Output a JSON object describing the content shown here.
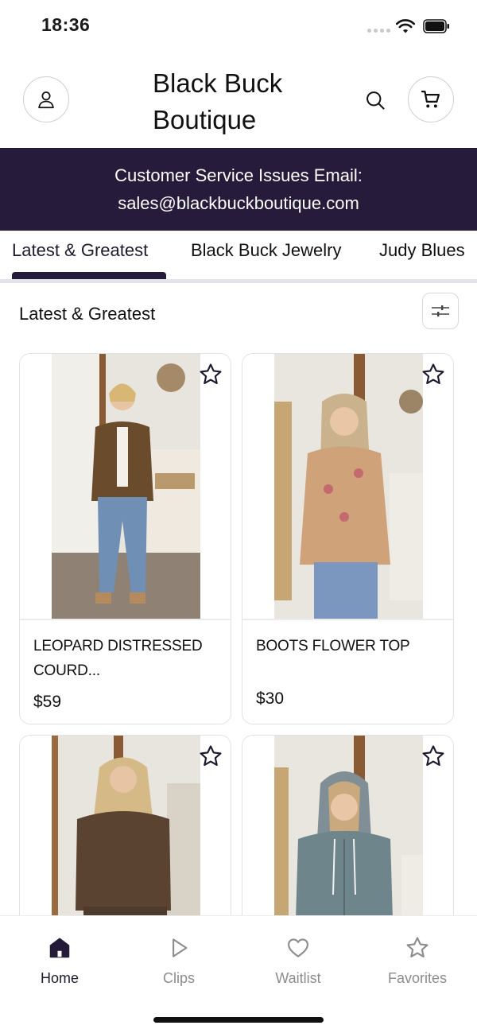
{
  "status_bar": {
    "time": "18:36"
  },
  "header": {
    "brand_line1": "Black Buck",
    "brand_line2": "Boutique",
    "icons": {
      "account": "user-icon",
      "search": "search-icon",
      "cart": "cart-icon"
    }
  },
  "banner": {
    "line1": "Customer Service Issues Email:",
    "line2": "sales@blackbuckboutique.com"
  },
  "tabs": [
    {
      "label": "Latest & Greatest",
      "active": true
    },
    {
      "label": "Black Buck Jewelry",
      "active": false
    },
    {
      "label": "Judy Blues",
      "active": false
    }
  ],
  "section": {
    "title": "Latest & Greatest"
  },
  "products": [
    {
      "title": "LEOPARD DISTRESSED COURD...",
      "price": "$59",
      "favorited": false
    },
    {
      "title": "BOOTS FLOWER TOP",
      "price": "$30",
      "favorited": false
    },
    {
      "title": "",
      "price": "",
      "favorited": false
    },
    {
      "title": "",
      "price": "",
      "favorited": false
    }
  ],
  "bottom_nav": [
    {
      "label": "Home",
      "icon": "home-icon",
      "active": true
    },
    {
      "label": "Clips",
      "icon": "play-icon",
      "active": false
    },
    {
      "label": "Waitlist",
      "icon": "heart-icon",
      "active": false
    },
    {
      "label": "Favorites",
      "icon": "star-icon",
      "active": false
    }
  ],
  "colors": {
    "brand_dark": "#261b3b",
    "tab_track": "#e3e4ea",
    "inactive_nav": "#8c8c8c"
  }
}
